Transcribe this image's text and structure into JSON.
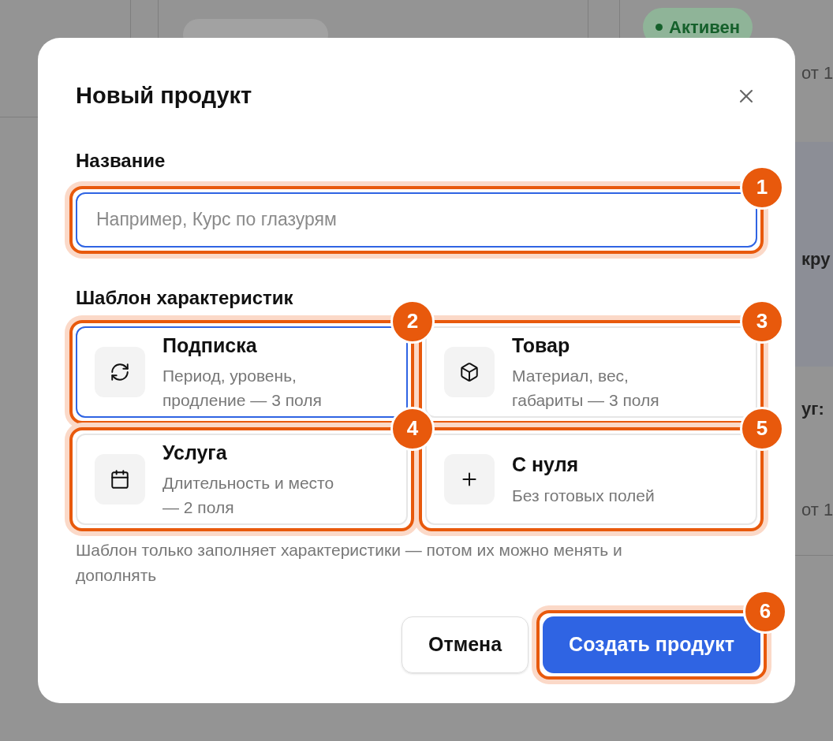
{
  "background": {
    "active_badge": "Активен",
    "fragments": [
      "от 1",
      "кру",
      "уг:",
      "от 1"
    ]
  },
  "dialog": {
    "title": "Новый продукт",
    "name_field": {
      "label": "Название",
      "placeholder": "Например, Курс по глазурям",
      "focused": true,
      "annotation": "1"
    },
    "template_label": "Шаблон характеристик",
    "templates": [
      {
        "title": "Подписка",
        "description": "Период, уровень, продление — 3 поля",
        "selected": true,
        "annotation": "2"
      },
      {
        "title": "Товар",
        "description": "Материал, вес, габариты — 3 поля",
        "selected": false,
        "annotation": "3"
      },
      {
        "title": "Услуга",
        "description": "Длительность и место — 2 поля",
        "selected": false,
        "annotation": "4"
      },
      {
        "title": "С нуля",
        "description": "Без готовых полей",
        "selected": false,
        "annotation": "5"
      }
    ],
    "hint": "Шаблон только заполняет характеристики — потом их можно менять и дополнять",
    "cancel_button": "Отмена",
    "create_button": {
      "label": "Создать продукт",
      "annotation": "6"
    }
  }
}
